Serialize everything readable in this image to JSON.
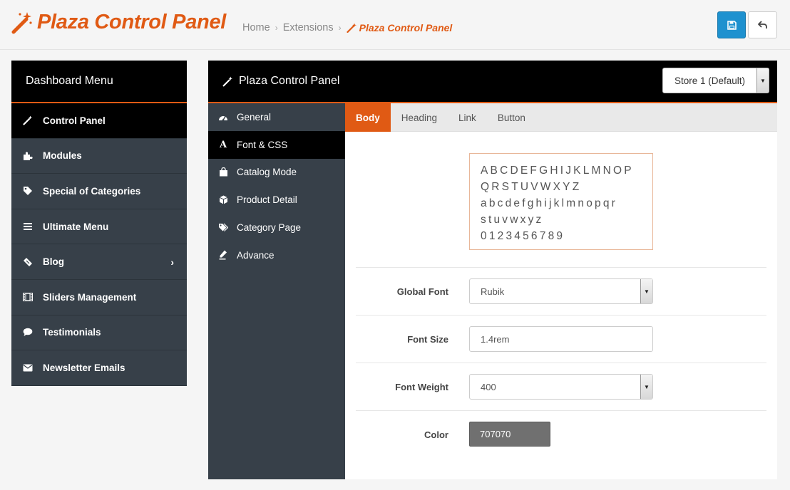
{
  "header": {
    "title": "Plaza Control Panel",
    "breadcrumb": [
      "Home",
      "Extensions",
      "Plaza Control Panel"
    ],
    "brand_color": "#e05a14"
  },
  "dashboard": {
    "title": "Dashboard Menu",
    "items": [
      {
        "label": "Control Panel",
        "icon": "magic-wand-icon",
        "active": true
      },
      {
        "label": "Modules",
        "icon": "puzzle-icon"
      },
      {
        "label": "Special of Categories",
        "icon": "tag-icon"
      },
      {
        "label": "Ultimate Menu",
        "icon": "bars-icon"
      },
      {
        "label": "Blog",
        "icon": "ticket-icon",
        "has_submenu": true,
        "chevron": "›"
      },
      {
        "label": "Sliders Management",
        "icon": "film-icon"
      },
      {
        "label": "Testimonials",
        "icon": "comment-icon"
      },
      {
        "label": "Newsletter Emails",
        "icon": "envelope-icon"
      }
    ]
  },
  "panel": {
    "title": "Plaza Control Panel",
    "store_select": "Store 1 (Default)",
    "subnav": [
      {
        "label": "General",
        "icon": "dashboard-icon"
      },
      {
        "label": "Font & CSS",
        "icon": "font-icon",
        "icon_glyph": "A",
        "active": true
      },
      {
        "label": "Catalog Mode",
        "icon": "shopping-bag-icon"
      },
      {
        "label": "Product Detail",
        "icon": "cube-icon"
      },
      {
        "label": "Category Page",
        "icon": "tags-icon"
      },
      {
        "label": "Advance",
        "icon": "eyedropper-icon"
      }
    ],
    "tabs": [
      {
        "label": "Body",
        "active": true
      },
      {
        "label": "Heading"
      },
      {
        "label": "Link"
      },
      {
        "label": "Button"
      }
    ],
    "preview_lines": [
      "ABCDEFGHIJKLMNOP",
      "QRSTUVWXYZ",
      "abcdefghijklmnopqr",
      "stuvwxyz",
      "0123456789"
    ],
    "form": {
      "global_font_label": "Global Font",
      "global_font_value": "Rubik",
      "font_size_label": "Font Size",
      "font_size_value": "1.4rem",
      "font_weight_label": "Font Weight",
      "font_weight_value": "400",
      "color_label": "Color",
      "color_value": "707070",
      "color_swatch": "#707070"
    }
  }
}
